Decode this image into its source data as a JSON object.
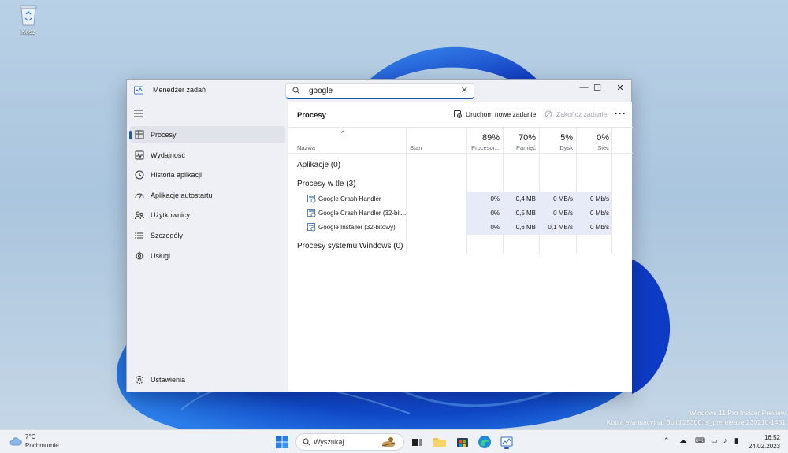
{
  "desktop": {
    "recycle_bin_label": "Kosz",
    "watermark_line1": "Windows 11 Pro Insider Preview",
    "watermark_line2": "Kopia ewaluacyjna. Build 25300.rs_prerelease.230210-1451"
  },
  "window": {
    "title": "Menedżer zadań",
    "search_value": "google",
    "controls": {
      "minimize": "—",
      "maximize": "☐",
      "close": "✕"
    }
  },
  "sidebar": {
    "items": [
      {
        "label": "Procesy",
        "icon": "processes-icon",
        "active": true
      },
      {
        "label": "Wydajność",
        "icon": "performance-icon"
      },
      {
        "label": "Historia aplikacji",
        "icon": "history-icon"
      },
      {
        "label": "Aplikacje autostartu",
        "icon": "startup-icon"
      },
      {
        "label": "Użytkownicy",
        "icon": "users-icon"
      },
      {
        "label": "Szczegóły",
        "icon": "details-icon"
      },
      {
        "label": "Usługi",
        "icon": "services-icon"
      }
    ],
    "settings_label": "Ustawienia"
  },
  "main": {
    "title": "Procesy",
    "run_new_task": "Uruchom nowe zadanie",
    "end_task": "Zakończ zadanie",
    "columns": {
      "name": "Nazwa",
      "status": "Stan",
      "cpu": {
        "pct": "89%",
        "label": "Procesor..."
      },
      "memory": {
        "pct": "70%",
        "label": "Pamięć"
      },
      "disk": {
        "pct": "5%",
        "label": "Dysk"
      },
      "network": {
        "pct": "0%",
        "label": "Sieć"
      }
    },
    "groups": {
      "apps": "Aplikacje (0)",
      "background": "Procesy w tle (3)",
      "system": "Procesy systemu Windows (0)"
    },
    "processes": [
      {
        "name": "Google Crash Handler",
        "cpu": "0%",
        "memory": "0,4 MB",
        "disk": "0 MB/s",
        "network": "0 Mb/s"
      },
      {
        "name": "Google Crash Handler (32-bit...",
        "cpu": "0%",
        "memory": "0,5 MB",
        "disk": "0 MB/s",
        "network": "0 Mb/s"
      },
      {
        "name": "Google Installer (32-bitowy)",
        "cpu": "0%",
        "memory": "0,6 MB",
        "disk": "0,1 MB/s",
        "network": "0 Mb/s"
      }
    ]
  },
  "taskbar": {
    "weather_temp": "7°C",
    "weather_condition": "Pochmurnie",
    "search_label": "Wyszukaj",
    "time": "16:52",
    "date": "24.02.2023"
  }
}
